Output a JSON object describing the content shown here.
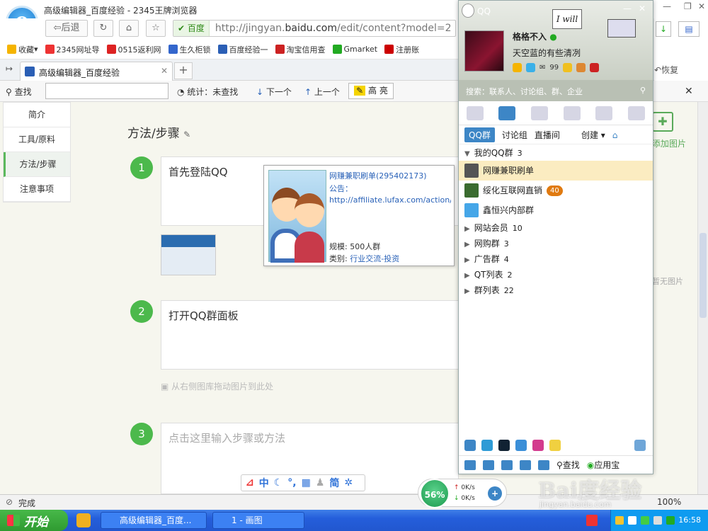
{
  "browser": {
    "window_title": "高级编辑器_百度经验 - 2345王牌浏览器",
    "back_label": "后退",
    "site_badge": "百度",
    "url_pre": "http://jingyan.",
    "url_host": "baidu.com",
    "url_post": "/edit/content?model=2",
    "favorites": [
      "收藏",
      "2345网址导",
      "0515返利网",
      "生久柜锁",
      "百度经验一",
      "淘宝信用查",
      "Gmarket",
      "注册账"
    ],
    "tab_title": "高级编辑器_百度经验",
    "find_label": "查找",
    "find_stats": "统计：未查找",
    "find_next": "下一个",
    "find_prev": "上一个",
    "find_highlight": "高 亮",
    "restore_label": "恢复",
    "status_text": "完成",
    "zoom": "100%"
  },
  "sidebar": {
    "items": [
      "简介",
      "工具/原料",
      "方法/步骤",
      "注意事项"
    ],
    "active_index": 2
  },
  "editor": {
    "section_title": "方法/步骤",
    "steps": [
      {
        "num": "1",
        "text": "首先登陆QQ"
      },
      {
        "num": "2",
        "text": "打开QQ群面板"
      },
      {
        "num": "3",
        "placeholder": "点击这里输入步骤或方法"
      }
    ],
    "drop_hint": "从右侧图库拖动图片到此处",
    "add_image": "添加图片",
    "no_image": "暂无图片"
  },
  "group_card": {
    "name": "网赚兼职刷单",
    "id": "(295402173)",
    "notice_label": "公告：",
    "notice_link": "http://affiliate.lufax.com/action/e..",
    "size_label": "规模:",
    "size_value": "500人群",
    "type_label": "类别:",
    "type_value": "行业交流-投资"
  },
  "qq": {
    "title": "QQ",
    "nickname": "格格不入",
    "signature": "天空蓝的有些清冽",
    "mail_count": "99",
    "search_placeholder": "搜索：联系人、讨论组、群、企业",
    "sub_tabs": [
      "QQ群",
      "讨论组",
      "直播间",
      "创建"
    ],
    "my_groups_label": "我的QQ群",
    "my_groups_count": "3",
    "my_groups": [
      {
        "name": "网赚兼职刷单",
        "badge": "",
        "color": "#555"
      },
      {
        "name": "绥化互联网直销",
        "badge": "40",
        "color": "#3a6b2f"
      },
      {
        "name": "鑫恒兴内部群",
        "badge": "",
        "color": "#45a6e8"
      }
    ],
    "folders": [
      {
        "name": "网站会员",
        "count": "10"
      },
      {
        "name": "网购群",
        "count": "3"
      },
      {
        "name": "广告群",
        "count": "4"
      },
      {
        "name": "QT列表",
        "count": "2"
      },
      {
        "name": "群列表",
        "count": "22"
      }
    ],
    "find_label": "查找",
    "app_store": "应用宝"
  },
  "ime": {
    "labels": [
      "中",
      "简"
    ]
  },
  "speed": {
    "percent": "56%",
    "up": "0K/s",
    "down": "0K/s"
  },
  "taskbar": {
    "start": "开始",
    "tasks": [
      "高级编辑器_百度...",
      "1 - 画图"
    ],
    "clock": "16:58"
  },
  "watermark": {
    "line1": "Bai度经验",
    "line2": "jingyan.baidu.com"
  },
  "colors": {
    "accent_green": "#4cb94c",
    "qq_blue": "#3d86c6",
    "taskbar_blue": "#245edb",
    "link_blue": "#2a62b8"
  }
}
